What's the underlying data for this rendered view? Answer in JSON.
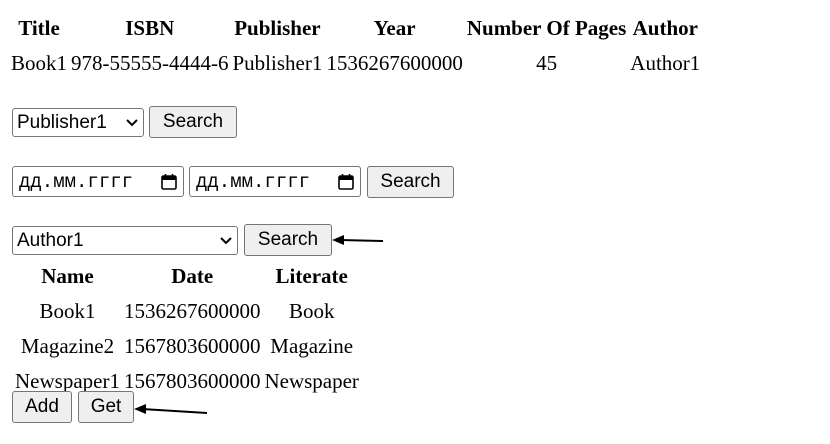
{
  "books_table": {
    "headers": [
      "Title",
      "ISBN",
      "Publisher",
      "Year",
      "Number Of Pages",
      "Author"
    ],
    "row": {
      "title": "Book1",
      "isbn": "978-55555-4444-6",
      "publisher": "Publisher1",
      "year": "1536267600000",
      "pages": "45",
      "author": "Author1"
    }
  },
  "publisher_filter": {
    "selected": "Publisher1",
    "search_label": "Search"
  },
  "date_filter": {
    "from_placeholder": "дд.мм.гггг",
    "to_placeholder": "дд.мм.гггг",
    "search_label": "Search"
  },
  "author_filter": {
    "selected": "Author1",
    "search_label": "Search"
  },
  "literature_table": {
    "headers": [
      "Name",
      "Date",
      "Literate"
    ],
    "rows": [
      {
        "name": "Book1",
        "date": "1536267600000",
        "literate": "Book"
      },
      {
        "name": "Magazine2",
        "date": "1567803600000",
        "literate": "Magazine"
      },
      {
        "name": "Newspaper1",
        "date": "1567803600000",
        "literate": "Newspaper"
      }
    ]
  },
  "actions": {
    "add_label": "Add",
    "get_label": "Get"
  },
  "icons": {
    "select": "chevron-down-icon",
    "date": "calendar-icon",
    "annotation": "arrow-left-icon"
  }
}
